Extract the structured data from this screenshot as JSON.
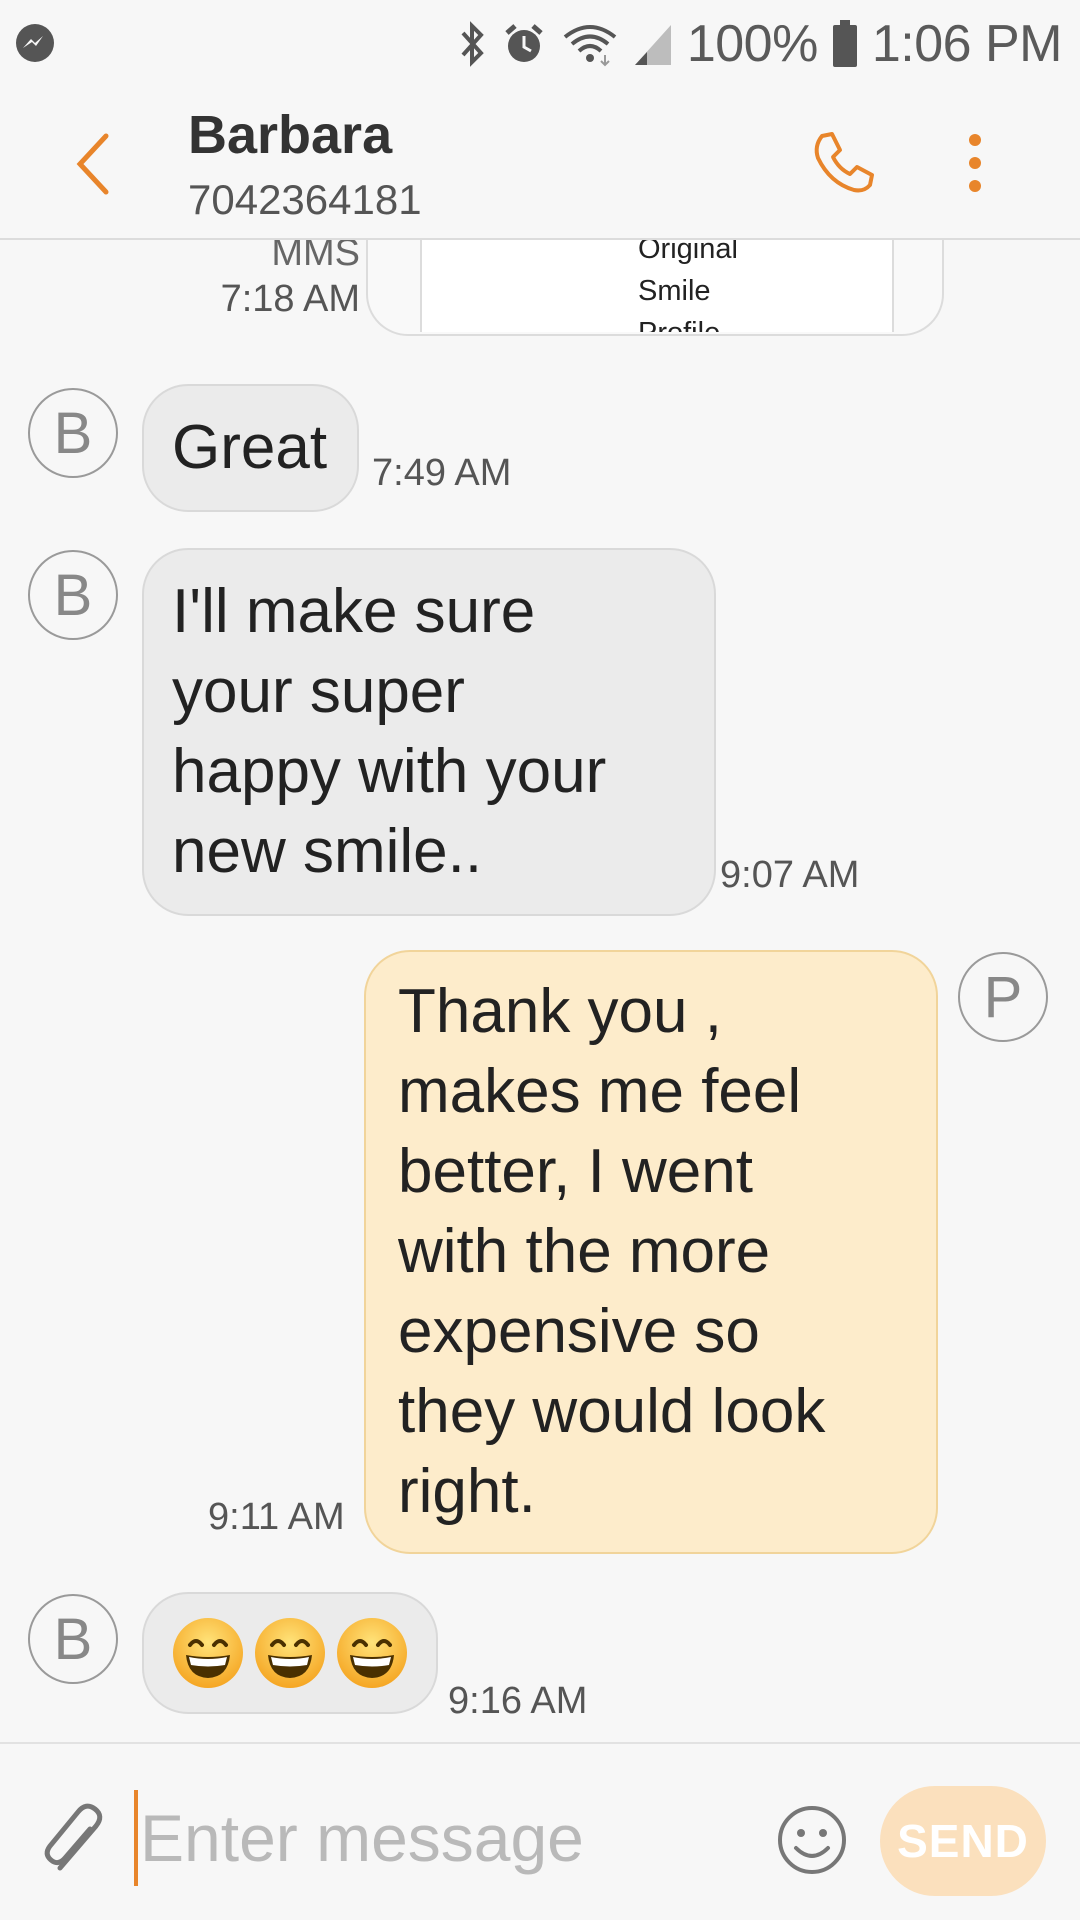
{
  "status_bar": {
    "battery_percent": "100%",
    "time": "1:06 PM",
    "icons": [
      "messenger-icon",
      "bluetooth-icon",
      "alarm-icon",
      "wifi-icon",
      "signal-icon",
      "battery-icon"
    ]
  },
  "header": {
    "contact_name": "Barbara",
    "contact_number": "7042364181"
  },
  "messages": {
    "mms": {
      "label": "MMS",
      "time": "7:18 AM",
      "preview_lines": [
        "Original",
        "Smile",
        "Profile"
      ]
    },
    "m1": {
      "sender_initial": "B",
      "text": "Great",
      "time": "7:49 AM"
    },
    "m2": {
      "sender_initial": "B",
      "lines": [
        "I'll make sure",
        "your super",
        "happy with your",
        "new smile.."
      ],
      "time": "9:07 AM"
    },
    "m3": {
      "sender_initial": "P",
      "lines": [
        "Thank you ,",
        "makes me feel",
        "better,  I went",
        "with the more",
        "expensive so",
        "they would look",
        "right."
      ],
      "time": "9:11 AM"
    },
    "m4": {
      "sender_initial": "B",
      "emoji_count": 3,
      "emoji_name": "grinning-face-with-smiling-eyes",
      "time": "9:16 AM"
    }
  },
  "composer": {
    "placeholder": "Enter message",
    "send_label": "SEND"
  },
  "colors": {
    "accent": "#e8852b",
    "incoming_bubble": "#ebebeb",
    "outgoing_bubble": "#fdeccb",
    "send_button": "#fbe0bd"
  }
}
